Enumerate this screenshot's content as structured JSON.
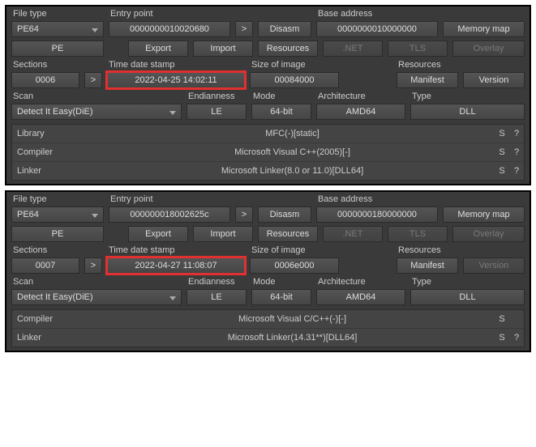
{
  "panels": [
    {
      "file_type_label": "File type",
      "file_type_value": "PE64",
      "entry_point_label": "Entry point",
      "entry_point_value": "0000000010020680",
      "gt": ">",
      "disasm": "Disasm",
      "base_address_label": "Base address",
      "base_address_value": "0000000010000000",
      "memory_map": "Memory map",
      "pe": "PE",
      "export": "Export",
      "import": "Import",
      "resources_btn": "Resources",
      "net": ".NET",
      "tls": "TLS",
      "overlay": "Overlay",
      "sections_label": "Sections",
      "sections_value": "0006",
      "sections_gt": ">",
      "tds_label": "Time date stamp",
      "tds_value": "2022-04-25 14:02:11",
      "soi_label": "Size of image",
      "soi_value": "00084000",
      "res_label": "Resources",
      "manifest": "Manifest",
      "version": "Version",
      "scan_label": "Scan",
      "scan_value": "Detect It Easy(DiE)",
      "endian_label": "Endianness",
      "endian_value": "LE",
      "mode_label": "Mode",
      "mode_value": "64-bit",
      "arch_label": "Architecture",
      "arch_value": "AMD64",
      "type_label": "Type",
      "type_value": "DLL",
      "results": [
        {
          "k": "Library",
          "v": "MFC(-)[static]",
          "s": "S",
          "q": "?"
        },
        {
          "k": "Compiler",
          "v": "Microsoft Visual C++(2005)[-]",
          "s": "S",
          "q": "?"
        },
        {
          "k": "Linker",
          "v": "Microsoft Linker(8.0 or 11.0)[DLL64]",
          "s": "S",
          "q": "?"
        }
      ]
    },
    {
      "file_type_label": "File type",
      "file_type_value": "PE64",
      "entry_point_label": "Entry point",
      "entry_point_value": "000000018002625c",
      "gt": ">",
      "disasm": "Disasm",
      "base_address_label": "Base address",
      "base_address_value": "0000000180000000",
      "memory_map": "Memory map",
      "pe": "PE",
      "export": "Export",
      "import": "Import",
      "resources_btn": "Resources",
      "net": ".NET",
      "tls": "TLS",
      "overlay": "Overlay",
      "sections_label": "Sections",
      "sections_value": "0007",
      "sections_gt": ">",
      "tds_label": "Time date stamp",
      "tds_value": "2022-04-27 11:08:07",
      "soi_label": "Size of image",
      "soi_value": "0006e000",
      "res_label": "Resources",
      "manifest": "Manifest",
      "version": "Version",
      "scan_label": "Scan",
      "scan_value": "Detect It Easy(DiE)",
      "endian_label": "Endianness",
      "endian_value": "LE",
      "mode_label": "Mode",
      "mode_value": "64-bit",
      "arch_label": "Architecture",
      "arch_value": "AMD64",
      "type_label": "Type",
      "type_value": "DLL",
      "results": [
        {
          "k": "Compiler",
          "v": "Microsoft Visual C/C++(-)[-]",
          "s": "S",
          "q": ""
        },
        {
          "k": "Linker",
          "v": "Microsoft Linker(14.31**)[DLL64]",
          "s": "S",
          "q": "?"
        }
      ]
    }
  ]
}
